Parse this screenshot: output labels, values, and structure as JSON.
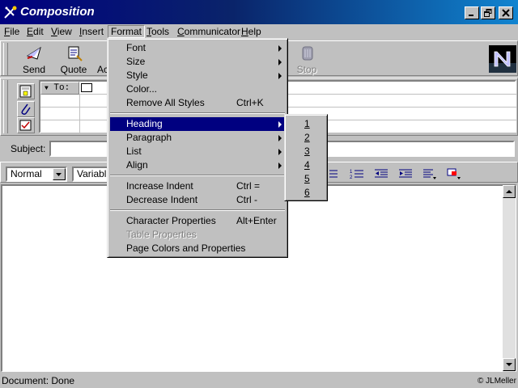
{
  "window": {
    "title": "Composition"
  },
  "menubar": {
    "items": [
      {
        "label": "File",
        "u": "F",
        "rest": "ile"
      },
      {
        "label": "Edit",
        "u": "E",
        "rest": "dit"
      },
      {
        "label": "View",
        "u": "V",
        "rest": "iew"
      },
      {
        "label": "Insert",
        "u": "I",
        "rest": "nsert"
      },
      {
        "label": "Format",
        "u": "",
        "rest": "Format"
      },
      {
        "label": "Tools",
        "u": "T",
        "rest": "ools"
      },
      {
        "label": "Communicator",
        "u": "C",
        "rest": "ommunicator"
      },
      {
        "label": "Help",
        "u": "H",
        "rest": "elp"
      }
    ]
  },
  "toolbar": {
    "send_label": "Send",
    "quote_label": "Quote",
    "address_label_partial": "Ac",
    "stop_label": "Stop"
  },
  "address": {
    "type_label": "To:"
  },
  "subject": {
    "label": "Subject:",
    "value": ""
  },
  "format_bar": {
    "paragraph_style": "Normal",
    "font": "Variable"
  },
  "format_menu": {
    "font": "Font",
    "size": "Size",
    "style": "Style",
    "color": "Color...",
    "remove_styles": "Remove All Styles",
    "remove_styles_shortcut": "Ctrl+K",
    "heading": "Heading",
    "paragraph": "Paragraph",
    "list": "List",
    "align": "Align",
    "increase_indent": "Increase Indent",
    "increase_indent_shortcut": "Ctrl =",
    "decrease_indent": "Decrease Indent",
    "decrease_indent_shortcut": "Ctrl -",
    "character_properties": "Character Properties",
    "character_properties_shortcut": "Alt+Enter",
    "table_properties": "Table Properties",
    "page_colors": "Page Colors and Properties"
  },
  "heading_submenu": {
    "levels": [
      "1",
      "2",
      "3",
      "4",
      "5",
      "6"
    ]
  },
  "status": {
    "text": "Document: Done",
    "credit": "© JLMeller"
  },
  "colors": {
    "title_bar": "#000080",
    "highlight": "#000080",
    "face": "#c0c0c0"
  },
  "icons": [
    "app-icon",
    "minimize-icon",
    "restore-icon",
    "close-icon",
    "send-icon",
    "quote-icon",
    "stop-icon",
    "netscape-logo",
    "address-card-icon",
    "attach-icon",
    "options-icon"
  ]
}
